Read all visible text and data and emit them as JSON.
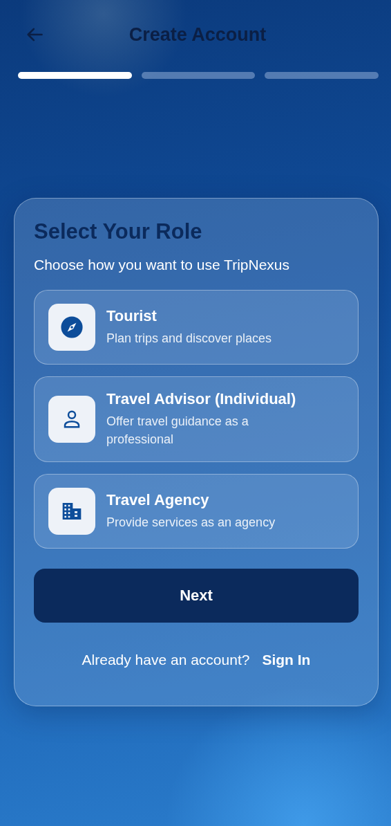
{
  "header": {
    "title": "Create Account"
  },
  "progress": [
    {
      "active": true
    },
    {
      "active": false
    },
    {
      "active": false
    }
  ],
  "card": {
    "title": "Select Your Role",
    "subtitle": "Choose how you want to use TripNexus",
    "roles": [
      {
        "kind": "tourist",
        "title": "Tourist",
        "description": "Plan trips and discover places",
        "selected": false
      },
      {
        "kind": "advisor",
        "title": "Travel Advisor (Individual)",
        "description": "Offer travel guidance as a professional",
        "selected": false
      },
      {
        "kind": "agency",
        "title": "Travel Agency",
        "description": "Provide services as an agency",
        "selected": false
      }
    ],
    "next_button": "Next",
    "signin_prompt": "Already have an account?",
    "signin_link": "Sign In"
  }
}
